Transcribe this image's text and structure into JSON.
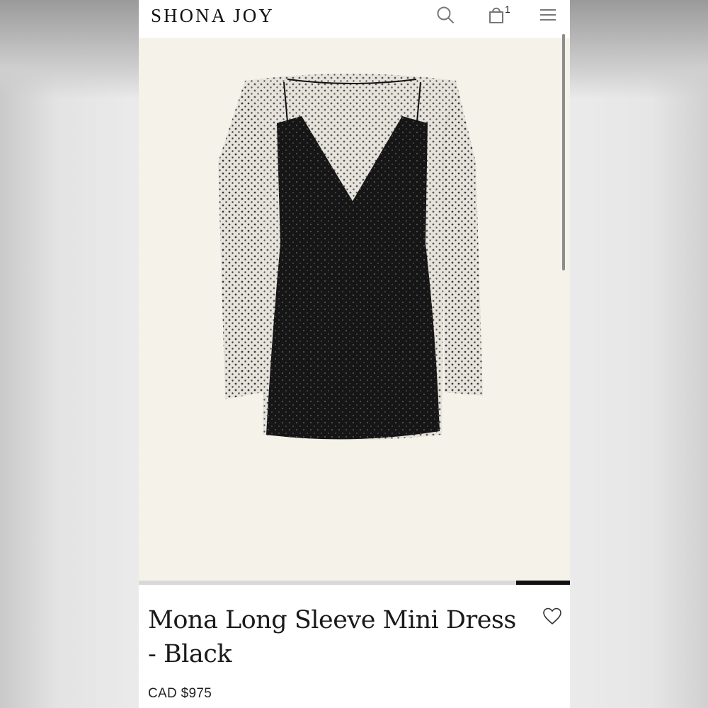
{
  "brand": {
    "logo_text": "SHONA JOY"
  },
  "header": {
    "search_icon": "search-icon",
    "bag_icon": "shopping-bag-icon",
    "cart_count": "1",
    "menu_icon": "hamburger-menu-icon"
  },
  "gallery": {
    "image_subject": "product-photo-dress",
    "slide_progress": 0.125
  },
  "product": {
    "title": "Mona Long Sleeve Mini Dress - Black",
    "price": "CAD $975",
    "wishlist_icon": "heart-icon"
  },
  "colors": {
    "image_background": "#f5f2ea",
    "text": "#1a1a1a",
    "accent": "#111111"
  }
}
